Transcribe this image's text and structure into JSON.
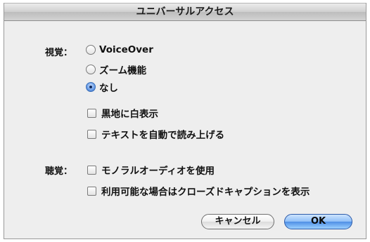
{
  "dialog": {
    "title": "ユニバーサルアクセス"
  },
  "vision": {
    "label": "視覚：",
    "options": [
      {
        "label": "VoiceOver",
        "selected": false
      },
      {
        "label": "ズーム機能",
        "selected": false
      },
      {
        "label": "なし",
        "selected": true
      }
    ],
    "checkboxes": [
      {
        "label": "黒地に白表示",
        "checked": false
      },
      {
        "label": "テキストを自動で読み上げる",
        "checked": false
      }
    ]
  },
  "hearing": {
    "label": "聴覚：",
    "checkboxes": [
      {
        "label": "モノラルオーディオを使用",
        "checked": false
      },
      {
        "label": "利用可能な場合はクローズドキャプションを表示",
        "checked": false
      }
    ]
  },
  "buttons": {
    "cancel_label": "キャンセル",
    "ok_label": "OK"
  },
  "colors": {
    "default_button": "#5b9bea",
    "selected_radio": "#3a6fb8"
  }
}
